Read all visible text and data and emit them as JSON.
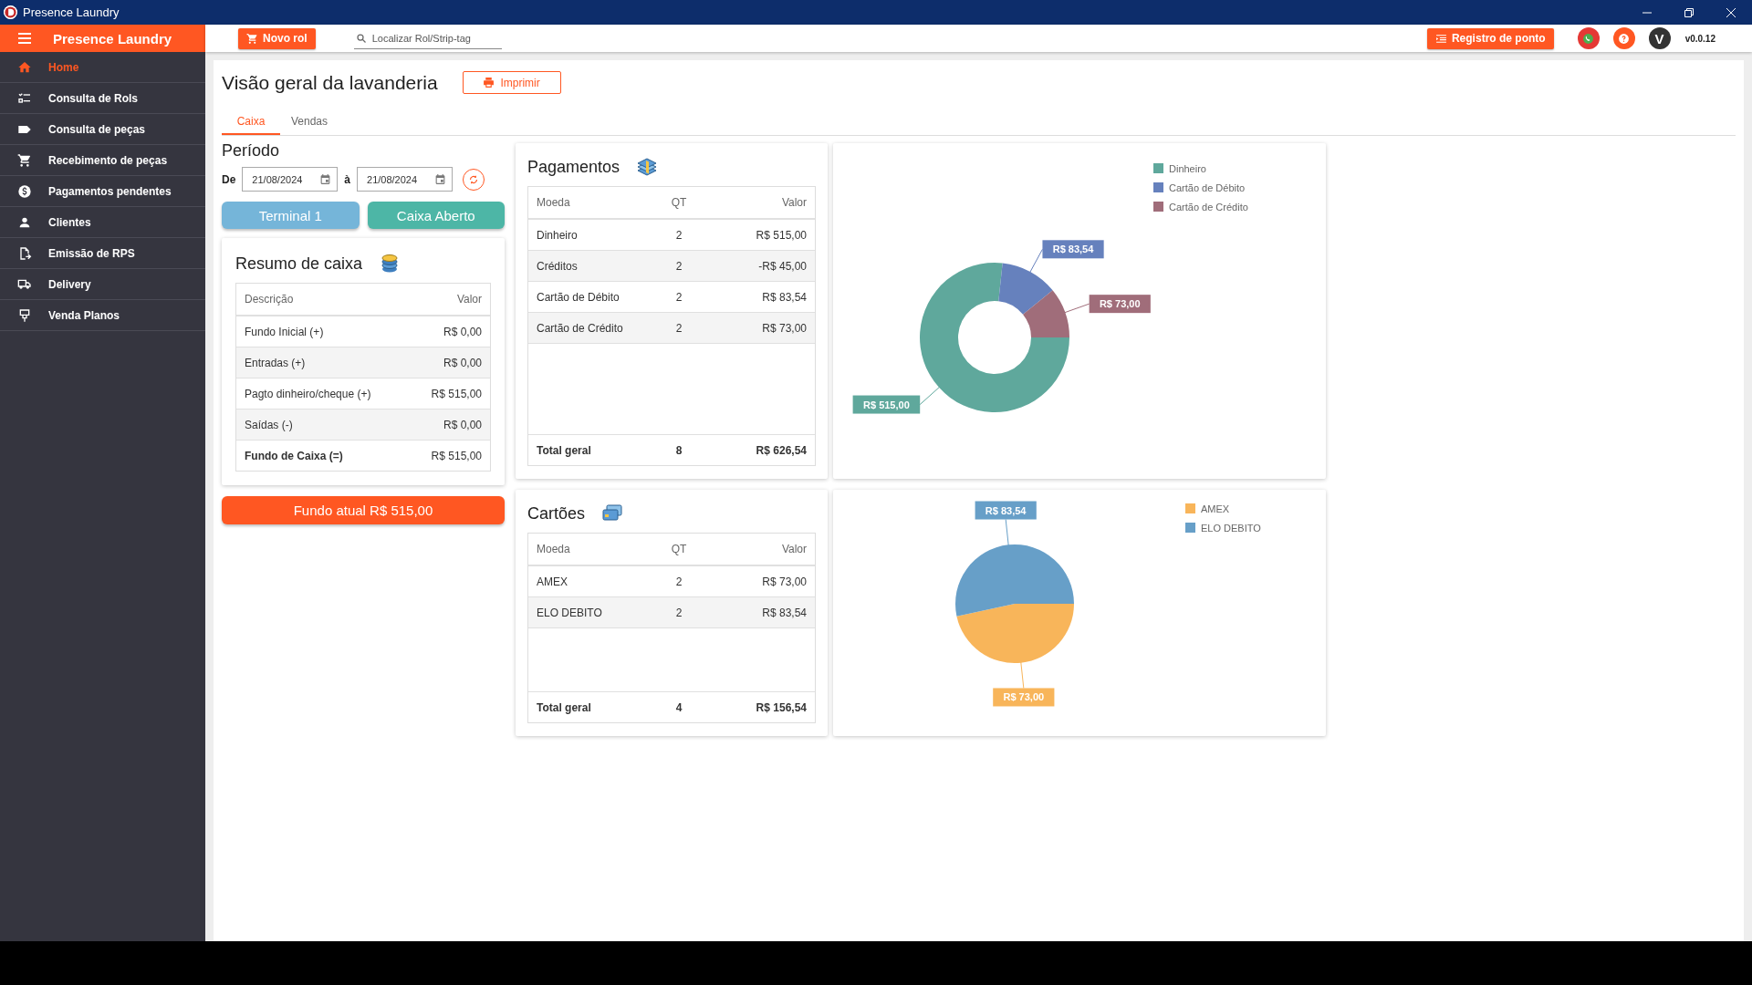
{
  "window": {
    "title": "Presence Laundry"
  },
  "sidebar": {
    "title": "Presence Laundry",
    "items": [
      {
        "label": "Home",
        "selected": true
      },
      {
        "label": "Consulta de Rols",
        "selected": false
      },
      {
        "label": "Consulta de peças",
        "selected": false
      },
      {
        "label": "Recebimento de peças",
        "selected": false
      },
      {
        "label": "Pagamentos pendentes",
        "selected": false
      },
      {
        "label": "Clientes",
        "selected": false
      },
      {
        "label": "Emissão de RPS",
        "selected": false
      },
      {
        "label": "Delivery",
        "selected": false
      },
      {
        "label": "Venda Planos",
        "selected": false
      }
    ]
  },
  "toolbar": {
    "new_button": "Novo rol",
    "search": {
      "placeholder": "Localizar Rol/Strip-tag"
    },
    "clock_button": "Registro de ponto",
    "avatar": "V",
    "version": "v0.0.12"
  },
  "page": {
    "title": "Visão geral da lavanderia",
    "print_button": "Imprimir",
    "tabs": [
      {
        "label": "Caixa",
        "selected": true
      },
      {
        "label": "Vendas",
        "selected": false
      }
    ]
  },
  "period": {
    "title": "Período",
    "from_label": "De",
    "from": "21/08/2024",
    "to_label": "à",
    "to": "21/08/2024",
    "terminal_button": "Terminal 1",
    "status_button": "Caixa Aberto"
  },
  "summary": {
    "title": "Resumo de caixa",
    "columns": [
      "Descrição",
      "Valor"
    ],
    "rows": [
      {
        "label": "Fundo Inicial (+)",
        "value": "R$ 0,00",
        "kind": "line"
      },
      {
        "label": "Entradas (+)",
        "value": "R$ 0,00",
        "kind": "line"
      },
      {
        "label": "Pagto dinheiro/cheque (+)",
        "value": "R$ 515,00",
        "kind": "line"
      },
      {
        "label": "Saídas (-)",
        "value": "R$ 0,00",
        "kind": "line"
      },
      {
        "label": "Fundo de Caixa (=)",
        "value": "R$ 515,00",
        "kind": "total"
      }
    ]
  },
  "current_fund_button": "Fundo atual R$ 515,00",
  "payments": {
    "title": "Pagamentos",
    "columns": [
      "Moeda",
      "QT",
      "Valor"
    ],
    "rows": [
      [
        "Dinheiro",
        "2",
        "R$ 515,00"
      ],
      [
        "Créditos",
        "2",
        "-R$ 45,00"
      ],
      [
        "Cartão de Débito",
        "2",
        "R$ 83,54"
      ],
      [
        "Cartão de Crédito",
        "2",
        "R$ 73,00"
      ]
    ],
    "total": [
      "Total geral",
      "8",
      "R$ 626,54"
    ],
    "chart_data": {
      "type": "donut",
      "categories": [
        "Dinheiro",
        "Cartão de Débito",
        "Cartão de Crédito"
      ],
      "colors": [
        "#5fa89c",
        "#6681bd",
        "#a06d7a"
      ],
      "values": [
        515.0,
        83.54,
        73.0
      ],
      "legend": "right",
      "value_labels": [
        "R$ 515,00",
        "R$ 83,54",
        "R$ 73,00"
      ]
    }
  },
  "cards": {
    "title": "Cartões",
    "columns": [
      "Moeda",
      "QT",
      "Valor"
    ],
    "rows": [
      [
        "AMEX",
        "2",
        "R$ 73,00"
      ],
      [
        "ELO DEBITO",
        "2",
        "R$ 83,54"
      ]
    ],
    "total": [
      "Total geral",
      "4",
      "R$ 156,54"
    ],
    "chart_data": {
      "type": "pie",
      "categories": [
        "AMEX",
        "ELO DEBITO"
      ],
      "colors": [
        "#f8b55a",
        "#679fc8"
      ],
      "values": [
        73.0,
        83.54
      ],
      "legend": "right",
      "value_labels": [
        "R$ 73,00",
        "R$ 83,54"
      ]
    }
  }
}
